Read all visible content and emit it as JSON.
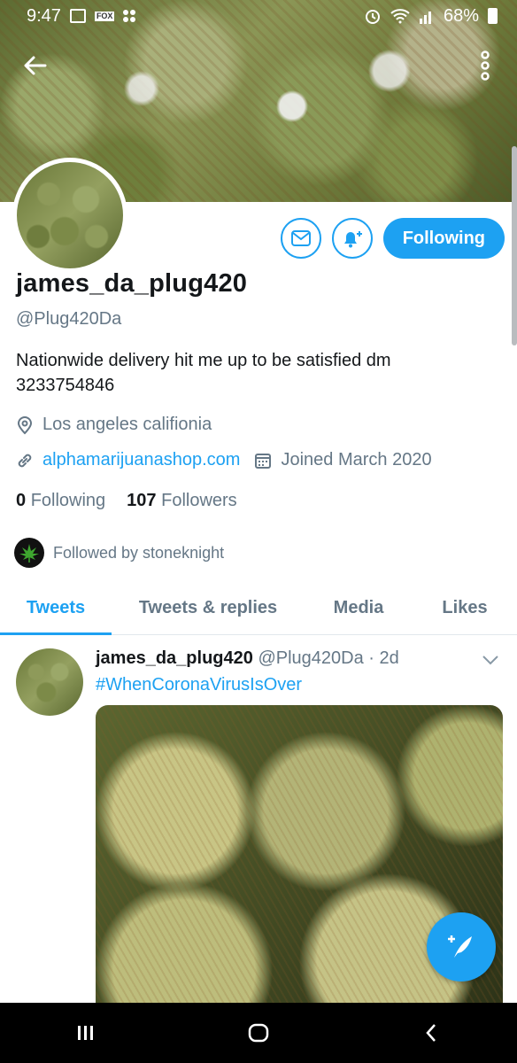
{
  "status_bar": {
    "time": "9:47",
    "battery": "68%"
  },
  "profile": {
    "display_name": "james_da_plug420",
    "handle": "@Plug420Da",
    "bio": "Nationwide delivery hit me up to be satisfied dm 3233754846",
    "location": "Los angeles califionia",
    "website": "alphamarijuanashop.com",
    "joined": "Joined March 2020",
    "following_count": "0",
    "following_label": "Following",
    "followers_count": "107",
    "followers_label": "Followers",
    "followed_by": "Followed by stoneknight"
  },
  "actions": {
    "following_button": "Following"
  },
  "tabs": [
    "Tweets",
    "Tweets & replies",
    "Media",
    "Likes"
  ],
  "active_tab": "Tweets",
  "tweet": {
    "name": "james_da_plug420",
    "handle_time": "@Plug420Da · 2d",
    "hashtag": "#WhenCoronaVirusIsOver"
  },
  "colors": {
    "accent": "#1da1f2",
    "secondary_text": "#657786",
    "primary_text": "#14171a"
  }
}
